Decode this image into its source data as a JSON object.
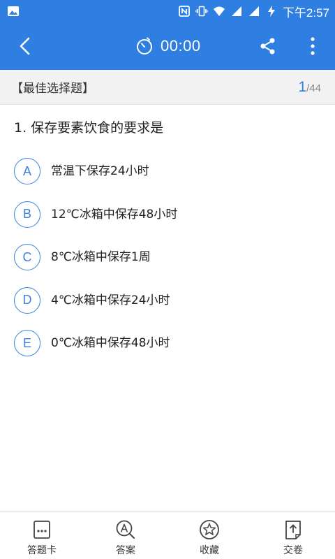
{
  "status_bar": {
    "time": "下午2:57"
  },
  "app_bar": {
    "timer": "00:00"
  },
  "question_type": "【最佳选择题】",
  "progress": {
    "current": "1",
    "total": "/44"
  },
  "question": {
    "text": "1. 保存要素饮食的要求是"
  },
  "options": [
    {
      "letter": "A",
      "text": "常温下保存24小时"
    },
    {
      "letter": "B",
      "text": "12℃冰箱中保存48小时"
    },
    {
      "letter": "C",
      "text": "8℃冰箱中保存1周"
    },
    {
      "letter": "D",
      "text": "4℃冰箱中保存24小时"
    },
    {
      "letter": "E",
      "text": "0℃冰箱中保存48小时"
    }
  ],
  "bottom_nav": [
    {
      "label": "答题卡",
      "icon": "answer-card-icon"
    },
    {
      "label": "答案",
      "icon": "answer-search-icon"
    },
    {
      "label": "收藏",
      "icon": "star-icon"
    },
    {
      "label": "交卷",
      "icon": "submit-icon"
    }
  ],
  "colors": {
    "primary": "#2f7fe3",
    "option_accent": "#3a82db",
    "type_bar_bg": "#f2f2f2"
  }
}
